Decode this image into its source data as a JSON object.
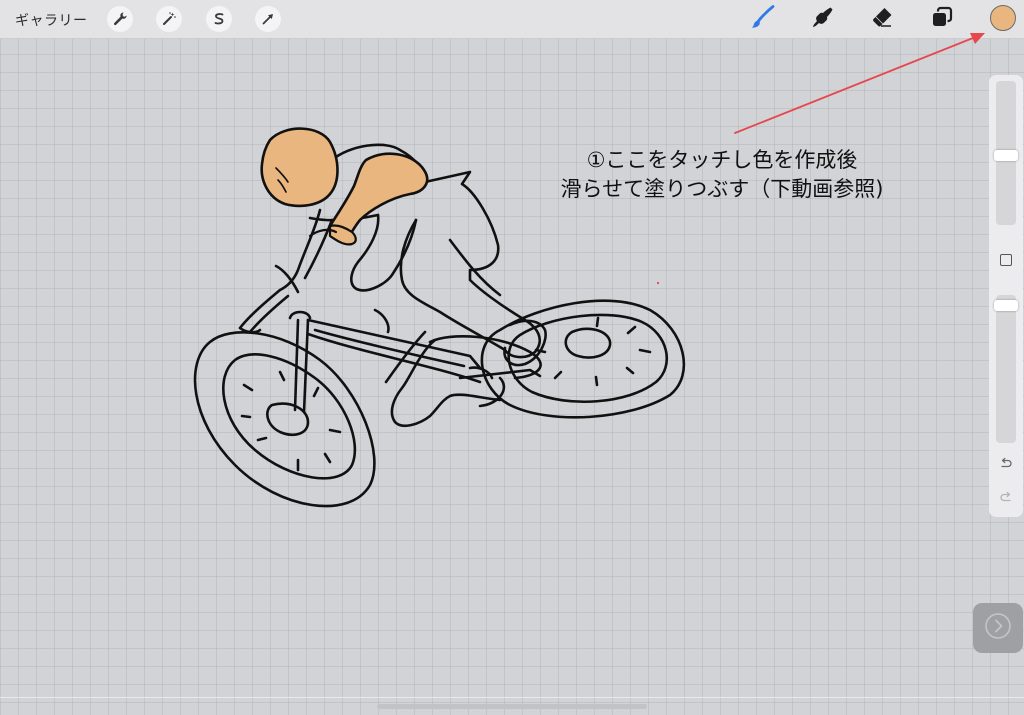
{
  "toolbar": {
    "gallery_label": "ギャラリー",
    "left_tools": [
      {
        "name": "actions",
        "icon": "wrench-icon"
      },
      {
        "name": "adjustments",
        "icon": "magic-wand-icon"
      },
      {
        "name": "selection",
        "icon": "selection-s-icon"
      },
      {
        "name": "transform",
        "icon": "transform-arrow-icon"
      }
    ],
    "right_tools": [
      {
        "name": "brush",
        "icon": "brush-icon",
        "active": true
      },
      {
        "name": "smudge",
        "icon": "smudge-finger-icon"
      },
      {
        "name": "eraser",
        "icon": "eraser-icon"
      },
      {
        "name": "layers",
        "icon": "layers-icon"
      }
    ],
    "current_color": "#e8b67e",
    "active_tool_color": "#2f7ae5"
  },
  "sidebar": {
    "brush_size_level": 0.52,
    "opacity_level": 0.04,
    "modify_icon": "square-icon",
    "undo_icon": "undo-icon",
    "redo_icon": "redo-icon"
  },
  "annotation": {
    "line1": "①ここをタッチし色を作成後",
    "line2": "滑らせて塗りつぶす（下動画参照)",
    "arrow_color": "#e5484d"
  },
  "canvas": {
    "background": "#d2d3d6",
    "fill_color": "#e8b67e",
    "subject": "cyclist line drawing"
  },
  "next_button_icon": "chevron-right-icon"
}
